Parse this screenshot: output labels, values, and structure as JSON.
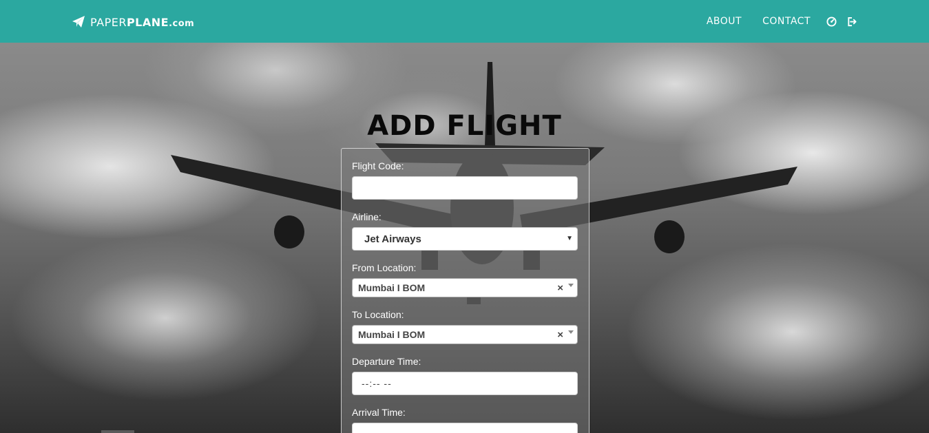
{
  "navbar": {
    "brand_light": "PAPER",
    "brand_bold": "PLANE",
    "brand_com": ".com",
    "links": [
      "ABOUT",
      "CONTACT"
    ],
    "icons": [
      "dashboard-icon",
      "logout-icon"
    ],
    "color": "#2ba8a0"
  },
  "page": {
    "title": "ADD FLIGHT"
  },
  "form": {
    "flight_code": {
      "label": "Flight Code:",
      "value": ""
    },
    "airline": {
      "label": "Airline:",
      "value": "Jet Airways"
    },
    "from_location": {
      "label": "From Location:",
      "value": "Mumbai I BOM",
      "clear": "×"
    },
    "to_location": {
      "label": "To Location:",
      "value": "Mumbai I BOM",
      "clear": "×"
    },
    "departure_time": {
      "label": "Departure Time:",
      "value": "--:-- --"
    },
    "arrival_time": {
      "label": "Arrival Time:",
      "value": ""
    }
  }
}
